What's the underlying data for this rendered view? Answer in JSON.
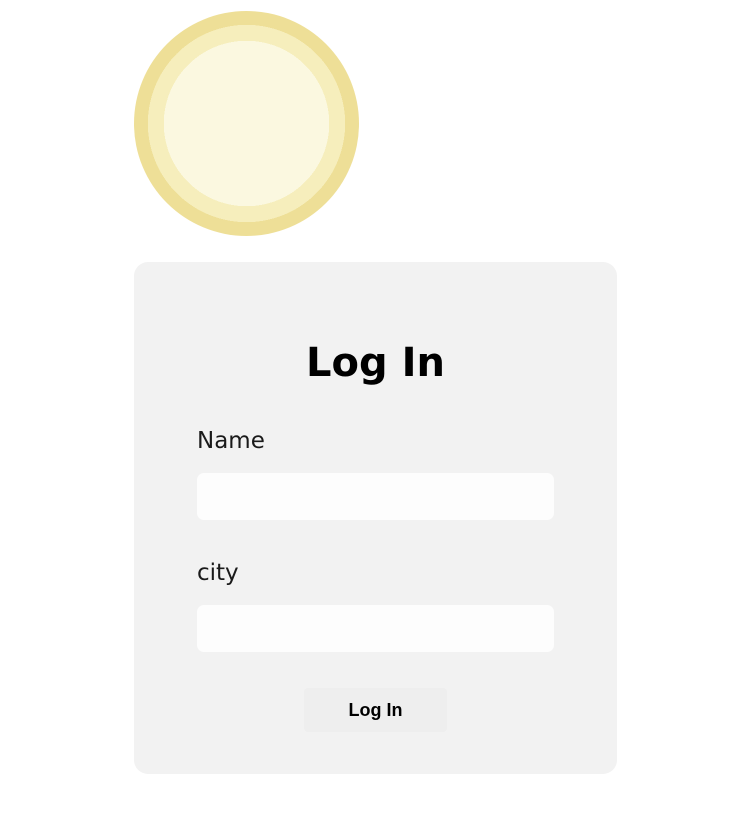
{
  "logo": {
    "icon": "sun-icon",
    "colors": [
      "#fbf8e0",
      "#f6eebc",
      "#eedf97",
      "#e3cf6c",
      "#d6bd41",
      "#c7ac28"
    ]
  },
  "login_form": {
    "title": "Log In",
    "fields": [
      {
        "label": "Name",
        "value": "",
        "placeholder": ""
      },
      {
        "label": "city",
        "value": "",
        "placeholder": ""
      }
    ],
    "submit_label": "Log In",
    "card_background": "#f2f2f2"
  }
}
